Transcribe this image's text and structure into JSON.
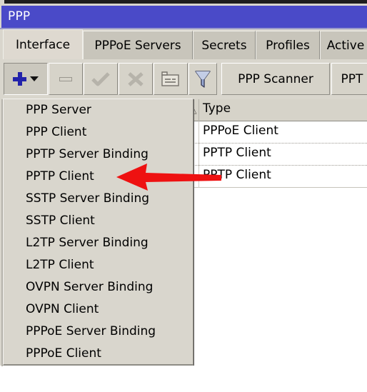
{
  "window": {
    "title": "PPP",
    "titlebar_color": "#4a4ac8",
    "chrome_color": "#d9d6cd"
  },
  "tabs": [
    {
      "label": "Interface",
      "active": true
    },
    {
      "label": "PPPoE Servers",
      "active": false
    },
    {
      "label": "Secrets",
      "active": false
    },
    {
      "label": "Profiles",
      "active": false
    },
    {
      "label": "Active",
      "active": false
    }
  ],
  "toolbar": {
    "add_button": {
      "icon": "plus-icon",
      "caret": "chevron-down-icon",
      "pressed": true
    },
    "remove_button": {
      "icon": "minus-icon",
      "enabled": true
    },
    "enable_button": {
      "icon": "check-icon",
      "enabled": false
    },
    "disable_button": {
      "icon": "cross-icon",
      "enabled": false
    },
    "comment_button": {
      "icon": "comment-icon",
      "enabled": true
    },
    "filter_button": {
      "icon": "funnel-icon",
      "enabled": true
    },
    "ppp_scanner_label": "PPP Scanner",
    "pptp_server_label": "PPT"
  },
  "dropdown": {
    "items": [
      "PPP Server",
      "PPP Client",
      "PPTP Server Binding",
      "PPTP Client",
      "SSTP Server Binding",
      "SSTP Client",
      "L2TP Server Binding",
      "L2TP Client",
      "OVPN Server Binding",
      "OVPN Client",
      "PPPoE Server Binding",
      "PPPoE Client"
    ],
    "highlighted_index": 3
  },
  "table": {
    "sort_indicator": "△",
    "columns": [
      "Type"
    ],
    "rows": [
      {
        "type": "PPPoE Client"
      },
      {
        "type": "PPTP Client"
      },
      {
        "type": "PPTP Client"
      }
    ]
  },
  "annotation": {
    "arrow_color": "#ee1111",
    "points_to": "PPTP Client"
  }
}
